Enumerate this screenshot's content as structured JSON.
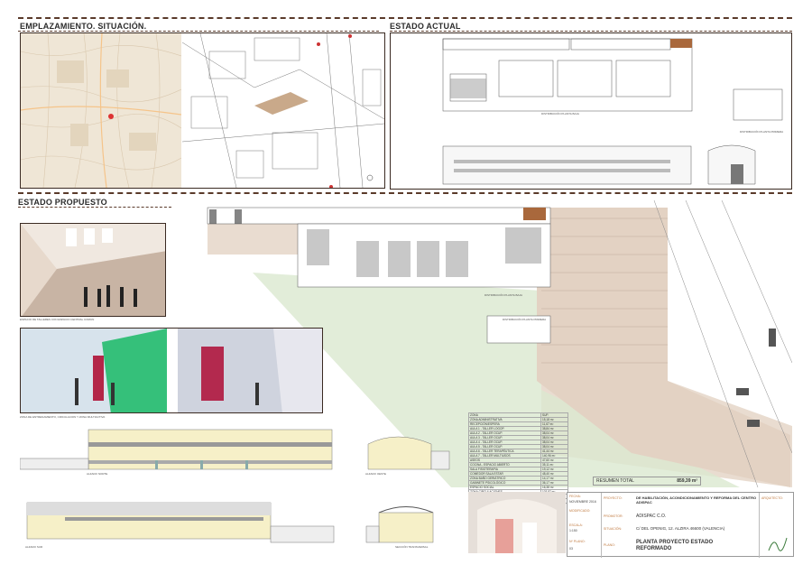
{
  "sections": {
    "location": "EMPLAZAMIENTO. SITUACIÓN.",
    "current": "ESTADO ACTUAL",
    "proposed": "ESTADO PROPUESTO"
  },
  "areas_table": {
    "headers": [
      "ZONA",
      "SUP."
    ],
    "rows": [
      [
        "ZONA ADMINISTRATIVA",
        "15,18 m²"
      ],
      [
        "RECEPCIÓN/ESPERA",
        "11,67 m²"
      ],
      [
        "AULA 1 - TALLER LOGOP.",
        "38,84 m²"
      ],
      [
        "AULA 2 - TALLER OCUP.",
        "38,04 m²"
      ],
      [
        "AULA 3 - TALLER OCUP.",
        "38,04 m²"
      ],
      [
        "AULA 4 - TALLER OCUP.",
        "38,04 m²"
      ],
      [
        "AULA 5 - TALLER OCUP.",
        "38,04 m²"
      ],
      [
        "AULA 6 - TALLER TERAPÉUTICA",
        "41,44 m²"
      ],
      [
        "AULA 7 - TALLER MULTIUSOS",
        "140,96 m²"
      ],
      [
        "ASEOS",
        "47,60 m²"
      ],
      [
        "COCINA - ESPACIO ABIERTO",
        "35,11 m²"
      ],
      [
        "SALA FISIOTERAPIA",
        "19,12 m²"
      ],
      [
        "COMEDOR SALA ESTAR",
        "48,40 m²"
      ],
      [
        "ZONA BAÑO GERIÁTRICO",
        "14,17 m²"
      ],
      [
        "GABINETE PSICOLÓGICO",
        "36,17 m²"
      ],
      [
        "ESPACIO SOCIAL",
        "16,38 m²"
      ],
      [
        "ZONA CIRCULACIONES",
        "103,87 m²"
      ],
      [
        "ZONA VESTUARIOS",
        "24,02 m²"
      ],
      [
        "ZONA INSTALACIONES",
        "26,90 m²"
      ]
    ]
  },
  "summary": {
    "label": "RESUMEN TOTAL",
    "value": "859,39 m²"
  },
  "title_block": {
    "fecha_label": "FECHA:",
    "fecha_value": "NOVIEMBRE 2016",
    "modificado_label": "MODIFICADO:",
    "escala_label": "ESCALA:",
    "escala_value": "1:150",
    "plano_label": "Nº PLANO:",
    "plano_value": "03",
    "proyecto_label": "PROYECTO:",
    "proyecto_value": "DE HABILITACIÓN, ACONDICIONAMIENTO Y REFORMA DEL CENTRO ADISPAC",
    "promotor_label": "PROMOTOR:",
    "promotor_value": "ADISPAC C.O.",
    "situacion_label": "SITUACIÓN:",
    "situacion_value": "C/ DEL OPENIG, 12. ALZIRA 46600 (VALENCIA)",
    "plano_name_label": "PLANO:",
    "plano_name_value": "PLANTA PROYECTO ESTADO REFORMADO",
    "arquitecto_label": "ARQUITECTO:"
  },
  "captions": {
    "plan_baja_actual": "DISTRIBUCIÓN PLANTA BAJA",
    "plan_primera_actual": "DISTRIBUCIÓN PLANTA PRIMERA",
    "plan_baja_prop": "DISTRIBUCIÓN PLANTA BAJA",
    "plan_primera_prop": "DISTRIBUCIÓN PLANTA PRIMERA",
    "render1": "ESPACIO DE TALLERES CON ESPACIO CENTRAL COMUN",
    "render2": "ZONA DE ENTRENAMIENTO, CIRCULACION Y ZONA MULTIACTIVA",
    "alzado_norte": "ALZADO NORTE",
    "alzado_oeste": "ALZADO OESTE",
    "alzado_sur": "ALZADO SUR",
    "seccion": "SECCIÓN TRANSVERSAL"
  },
  "colors": {
    "dash": "#5a3a2a",
    "map_bg": "#efe6d6",
    "parcel": "#e9dcd0",
    "green": "#dbe9cf",
    "wood": "#a9683c"
  }
}
